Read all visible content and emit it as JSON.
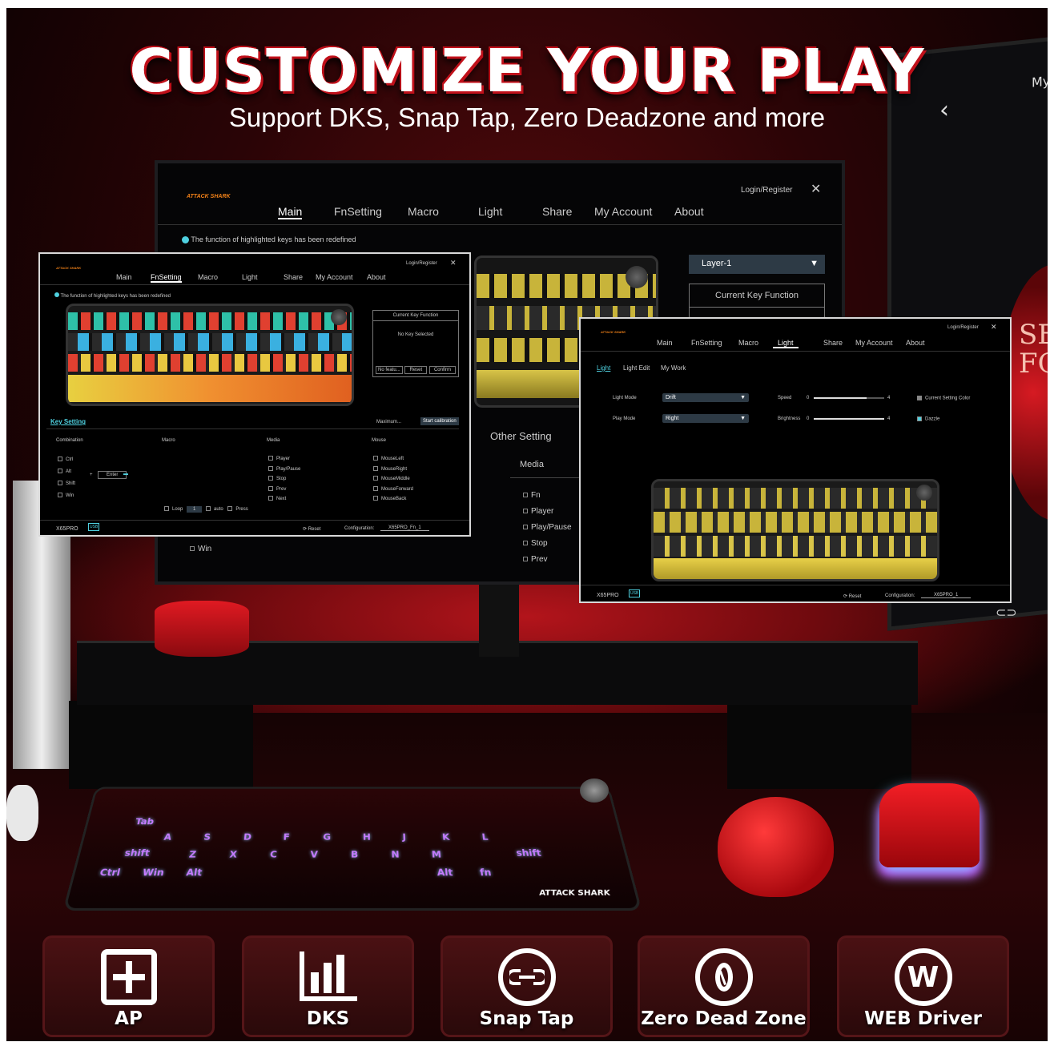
{
  "hero": {
    "title": "CUSTOMIZE YOUR PLAY",
    "subtitle": "Support DKS, Snap Tap, Zero Deadzone and more"
  },
  "brand": {
    "logo": "ATTACK SHARK",
    "accent": "#e01a22",
    "highlight": "#4fd1e0"
  },
  "main_app": {
    "login": "Login/Register",
    "tabs": [
      "Main",
      "FnSetting",
      "Macro",
      "Light",
      "Share",
      "My Account",
      "About"
    ],
    "active_tab": "Main",
    "notice": "The function of highlighted keys has been redefined",
    "layer_select": "Layer-1",
    "current_key_function": "Current Key Function",
    "other_setting": "Other Setting",
    "media_title": "Media",
    "media_items": [
      "Fn",
      "Player",
      "Play/Pause",
      "Stop",
      "Prev"
    ],
    "win_label": "Win"
  },
  "fn_window": {
    "login": "Login/Register",
    "tabs": [
      "Main",
      "FnSetting",
      "Macro",
      "Light",
      "Share",
      "My Account",
      "About"
    ],
    "active_tab": "FnSetting",
    "notice": "The function of highlighted keys has been redefined",
    "current_key_function": "Current Key Function",
    "no_key": "No Key Selected",
    "buttons": [
      "No featu...",
      "Reset",
      "Confirm"
    ],
    "key_setting": "Key Setting",
    "maximum": "Maximum...",
    "calibration": "Start calibration",
    "columns": [
      "Combination",
      "Macro",
      "Media",
      "Mouse"
    ],
    "combination": [
      "Ctrl",
      "Alt",
      "Shift",
      "Win"
    ],
    "enter": "Enter",
    "media": [
      "Player",
      "Play/Pause",
      "Stop",
      "Prev",
      "Next"
    ],
    "mouse": [
      "MouseLeft",
      "MouseRight",
      "MouseMiddle",
      "MouseForward",
      "MouseBack"
    ],
    "loop": "Loop",
    "loop_value": "1",
    "auto": "auto",
    "press": "Press",
    "device": "X65PRO",
    "usb": "USB",
    "reset": "Reset",
    "configuration_label": "Configuration:",
    "configuration_value": "X65PRO_Fn_1"
  },
  "light_window": {
    "login": "Login/Register",
    "tabs": [
      "Main",
      "FnSetting",
      "Macro",
      "Light",
      "Share",
      "My Account",
      "About"
    ],
    "active_tab": "Light",
    "subtabs": [
      "Light",
      "Light Edit",
      "My Work"
    ],
    "light_mode_label": "Light Mode",
    "light_mode_value": "Drift",
    "play_mode_label": "Play Mode",
    "play_mode_value": "Right",
    "speed_label": "Speed",
    "brightness_label": "Brightness",
    "slider_min": "0",
    "slider_max": "4",
    "speed_level": 0.75,
    "brightness_level": 1.0,
    "current_color": "Current Setting Color",
    "dazzle": "Dazzle",
    "device": "X65PRO",
    "usb": "USB",
    "reset": "Reset",
    "configuration_label": "Configuration:",
    "configuration_value": "X65PRO_1"
  },
  "right_monitor": {
    "text": "My",
    "side_text": "SE GO FOR"
  },
  "keyboard_keys": [
    "Ctrl",
    "Win",
    "Alt",
    "Alt",
    "fn",
    "shift",
    "shift",
    "Tab",
    "A",
    "S",
    "D",
    "F",
    "G",
    "H",
    "J",
    "K",
    "L",
    "Z",
    "X",
    "C",
    "V",
    "B",
    "N",
    "M"
  ],
  "keyboard_logo": "ATTACK SHARK",
  "features": [
    {
      "label": "AP",
      "icon": "plus-square-icon"
    },
    {
      "label": "DKS",
      "icon": "bar-chart-icon"
    },
    {
      "label": "Snap Tap",
      "icon": "snap-tap-icon"
    },
    {
      "label": "Zero Dead Zone",
      "icon": "zero-circle-icon"
    },
    {
      "label": "WEB Driver",
      "icon": "w-circle-icon"
    }
  ]
}
